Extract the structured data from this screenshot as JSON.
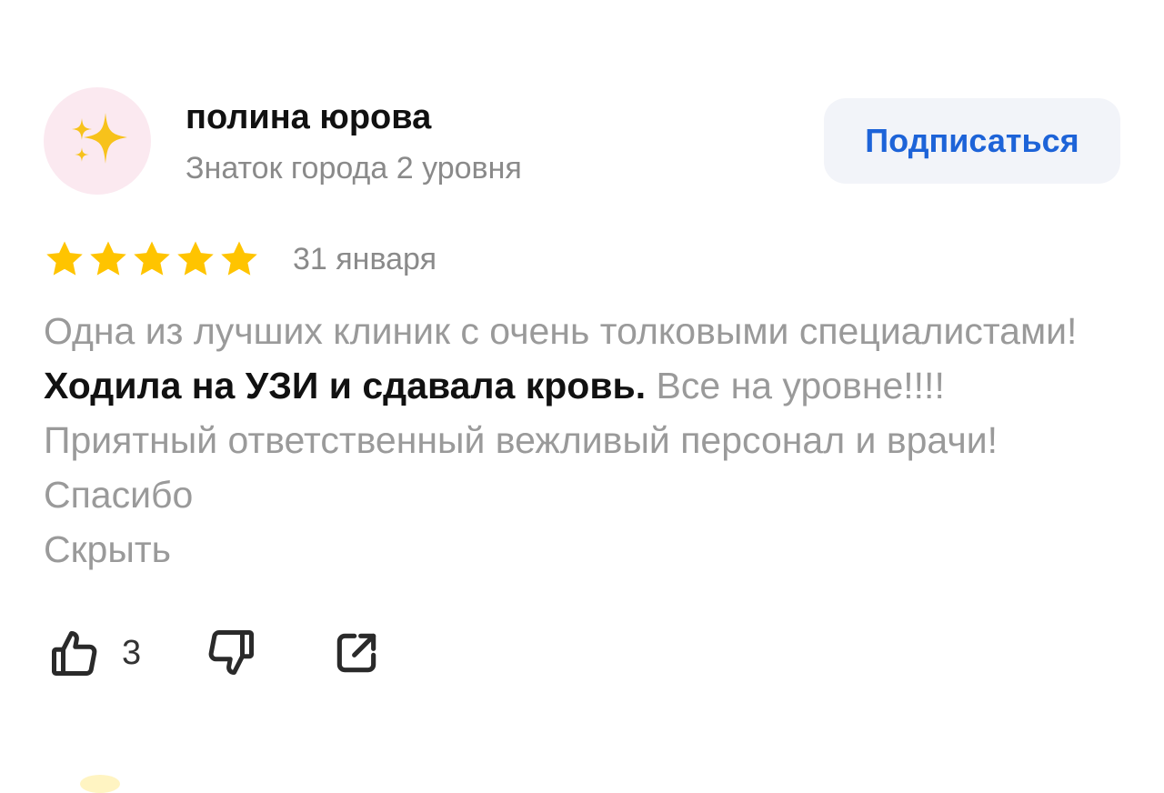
{
  "author": {
    "name": "полина юрова",
    "level": "Знаток города 2 уровня",
    "avatar_icon": "sparkles-icon"
  },
  "subscribe": {
    "label": "Подписаться"
  },
  "review": {
    "rating": 5,
    "max_rating": 5,
    "date": "31 января",
    "text_part1": "Одна из лучших клиник с очень толковыми специалистами! ",
    "text_highlight": "Ходила на УЗИ и сдавала кровь.",
    "text_part2": " Все на уровне!!!! Приятный ответственный вежливый персонал и врачи! Спасибо",
    "hide_label": "Скрыть"
  },
  "actions": {
    "likes_count": "3",
    "like_icon": "thumbs-up-icon",
    "dislike_icon": "thumbs-down-icon",
    "share_icon": "share-icon"
  },
  "colors": {
    "accent": "#1d63d8",
    "star": "#ffc400",
    "muted_text": "#9a9a9a",
    "button_bg": "#f2f4f9",
    "avatar_bg": "#fbe9f0"
  }
}
